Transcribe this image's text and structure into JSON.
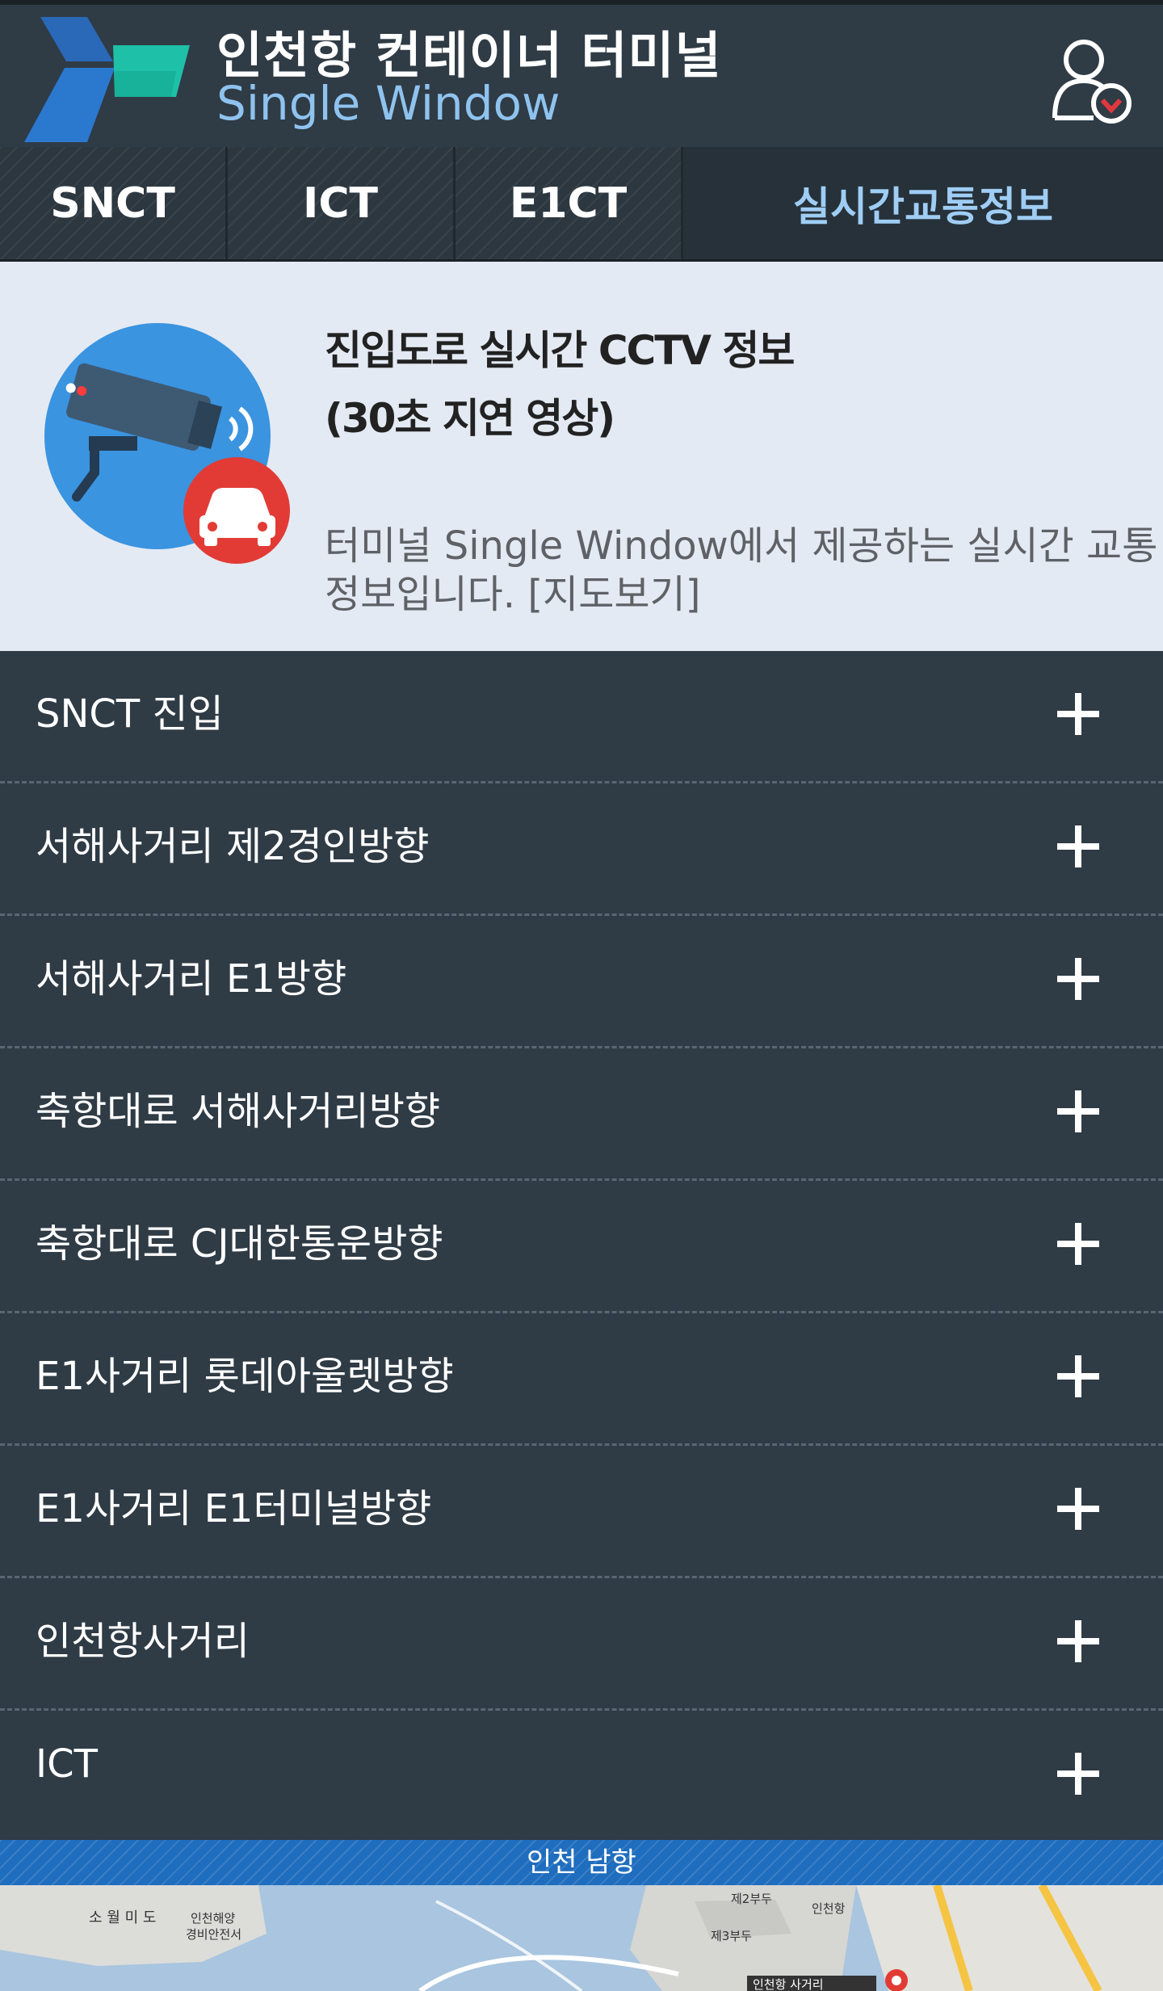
{
  "header": {
    "title_ko": "인천항 컨테이너 터미널",
    "title_en": "Single Window",
    "logo_icon": "port-logo-icon",
    "user_icon": "user-settings-icon"
  },
  "tabs": [
    {
      "label": "SNCT",
      "active": false
    },
    {
      "label": "ICT",
      "active": false
    },
    {
      "label": "E1CT",
      "active": false
    },
    {
      "label": "실시간교통정보",
      "active": true
    }
  ],
  "info": {
    "icon": "cctv-camera-car-icon",
    "title_line1": "진입도로 실시간 CCTV 정보",
    "title_line2": "(30초 지연 영상)",
    "desc_line1": "터미널 Single Window에서 제공하는 실시간 교통",
    "desc_line2_prefix": "정보입니다. ",
    "map_link": "[지도보기]"
  },
  "cctv_list": [
    {
      "label": "SNCT 진입"
    },
    {
      "label": "서해사거리 제2경인방향"
    },
    {
      "label": "서해사거리 E1방향"
    },
    {
      "label": "축항대로 서해사거리방향"
    },
    {
      "label": "축항대로 CJ대한통운방향"
    },
    {
      "label": "E1사거리 롯데아울렛방향"
    },
    {
      "label": "E1사거리 E1터미널방향"
    },
    {
      "label": "인천항사거리"
    },
    {
      "label": "ICT"
    }
  ],
  "map": {
    "header": "인천 남항",
    "labels": [
      "소 월 미 도",
      "인천해양",
      "경비안전서",
      "제2부두",
      "인천항",
      "제3부두",
      "인천항 사거리"
    ]
  },
  "colors": {
    "background": "#2f3b45",
    "active_tab_text": "#9fcdf4",
    "info_bg": "#e4eaf3",
    "map_header": "#1f6dbe"
  }
}
